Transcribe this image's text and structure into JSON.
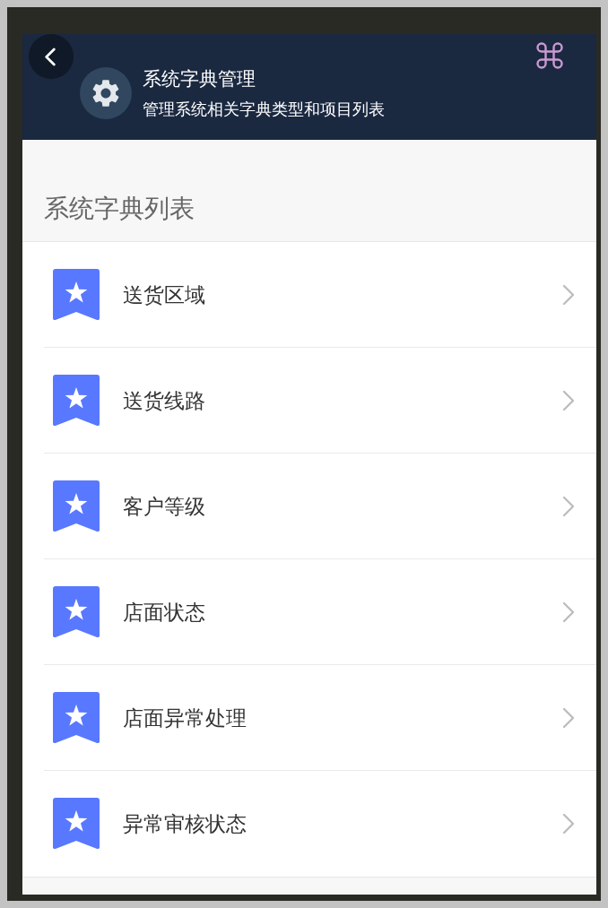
{
  "header": {
    "title": "系统字典管理",
    "subtitle": "管理系统相关字典类型和项目列表"
  },
  "section": {
    "heading": "系统字典列表"
  },
  "items": [
    {
      "label": "送货区域"
    },
    {
      "label": "送货线路"
    },
    {
      "label": "客户等级"
    },
    {
      "label": "店面状态"
    },
    {
      "label": "店面异常处理"
    },
    {
      "label": "异常审核状态"
    }
  ]
}
